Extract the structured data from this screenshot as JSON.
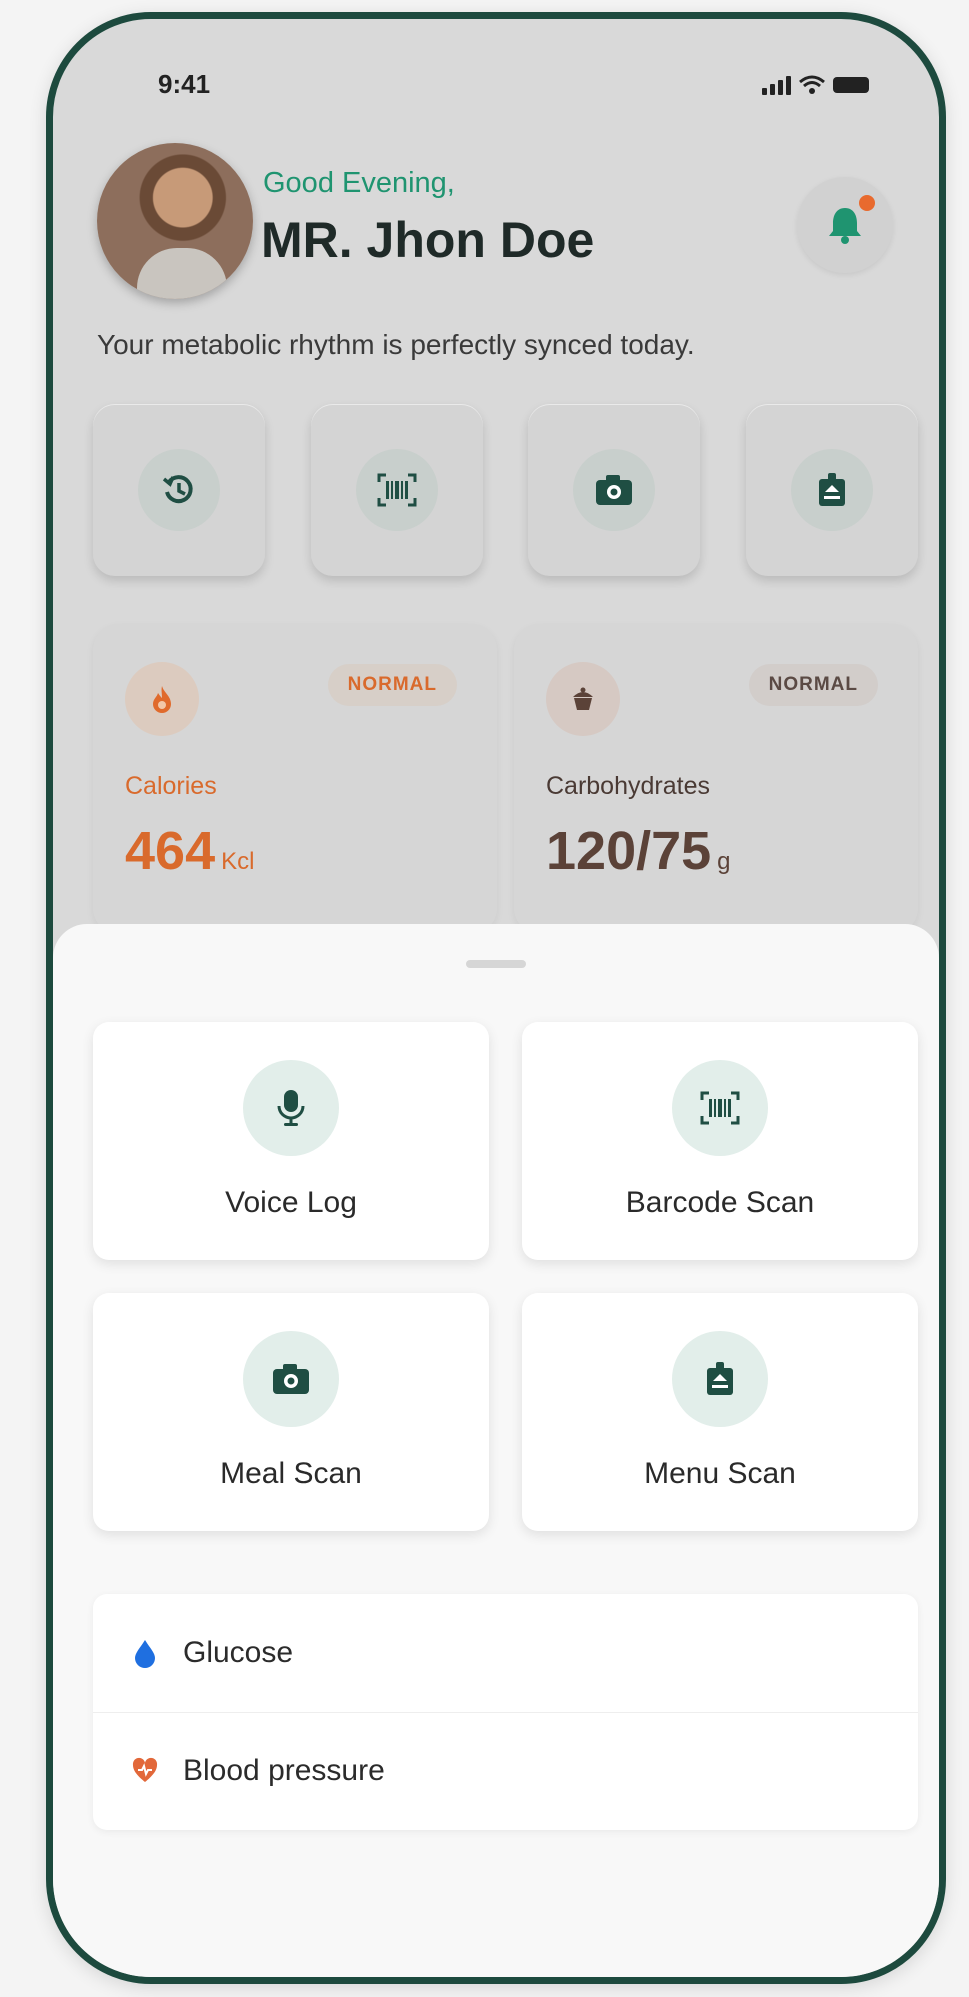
{
  "status_bar": {
    "time": "9:41"
  },
  "header": {
    "greeting": "Good Evening,",
    "user_name": "MR. Jhon Doe",
    "tagline": "Your metabolic rhythm is perfectly synced today."
  },
  "quick_actions": [
    {
      "icon": "history-icon"
    },
    {
      "icon": "barcode-icon"
    },
    {
      "icon": "camera-icon"
    },
    {
      "icon": "menu-scan-icon"
    }
  ],
  "stats": {
    "calories": {
      "badge": "NORMAL",
      "label": "Calories",
      "value": "464",
      "unit": "Kcl",
      "color": "#d96a2c"
    },
    "carbohydrates": {
      "badge": "NORMAL",
      "label": "Carbohydrates",
      "value": "120/75",
      "unit": "g",
      "color": "#5b4238"
    }
  },
  "sheet": {
    "actions": [
      {
        "label": "Voice Log",
        "icon": "microphone-icon"
      },
      {
        "label": "Barcode Scan",
        "icon": "barcode-icon"
      },
      {
        "label": "Meal Scan",
        "icon": "camera-icon"
      },
      {
        "label": "Menu Scan",
        "icon": "menu-scan-icon"
      }
    ],
    "list": [
      {
        "label": "Glucose",
        "icon": "drop-icon",
        "color": "#1f6fe0"
      },
      {
        "label": "Blood pressure",
        "icon": "heart-pressure-icon",
        "color": "#e2683a"
      }
    ]
  },
  "colors": {
    "accent": "#1f4e43",
    "green": "#1f9470",
    "frame": "#1d4a3e"
  }
}
